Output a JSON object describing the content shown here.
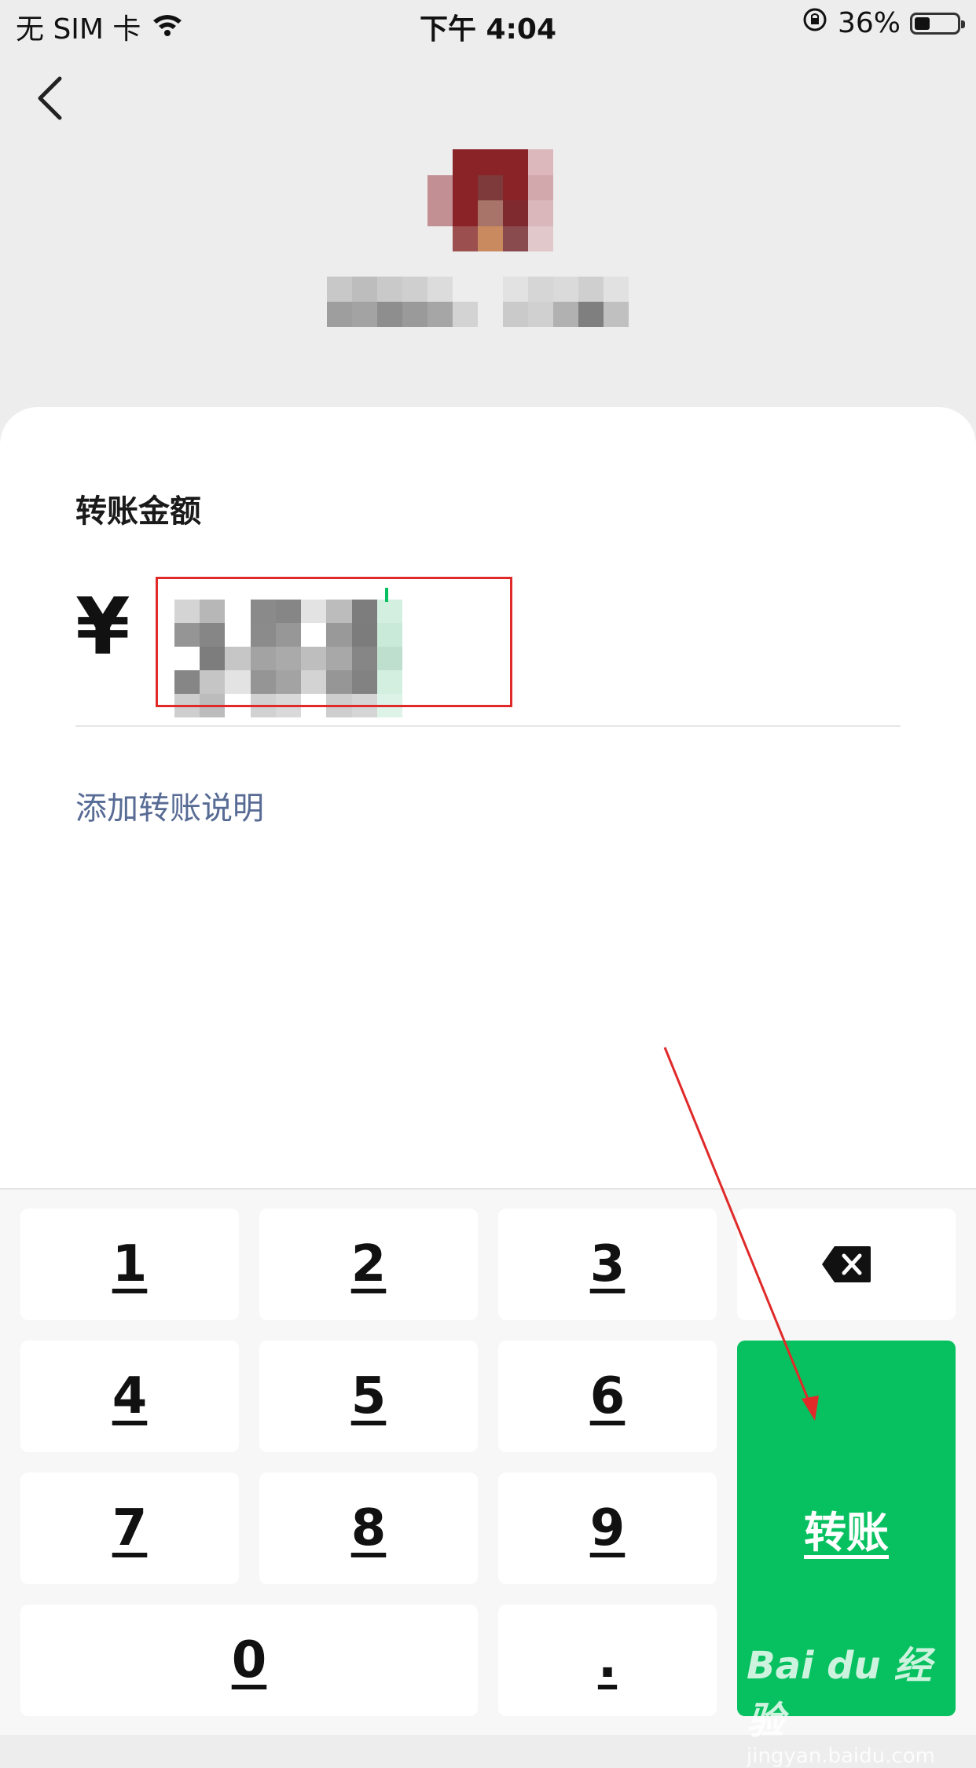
{
  "status_bar": {
    "carrier": "无 SIM 卡",
    "time": "下午 4:04",
    "battery_percent": "36%",
    "battery_level": 0.36
  },
  "header": {
    "back_icon": "chevron-left-icon"
  },
  "transfer": {
    "amount_label": "转账金额",
    "currency_symbol": "¥",
    "add_note_label": "添加转账说明"
  },
  "keypad": {
    "keys": [
      "1",
      "2",
      "3",
      "4",
      "5",
      "6",
      "7",
      "8",
      "9",
      "0",
      "."
    ],
    "delete_icon": "backspace-icon",
    "confirm_label": "转账"
  },
  "watermark": {
    "logo": "Bai du 经验",
    "url": "jingyan.baidu.com"
  },
  "colors": {
    "accent_green": "#07c160",
    "link_blue": "#576b95",
    "annotation_red": "#e02a2a"
  }
}
